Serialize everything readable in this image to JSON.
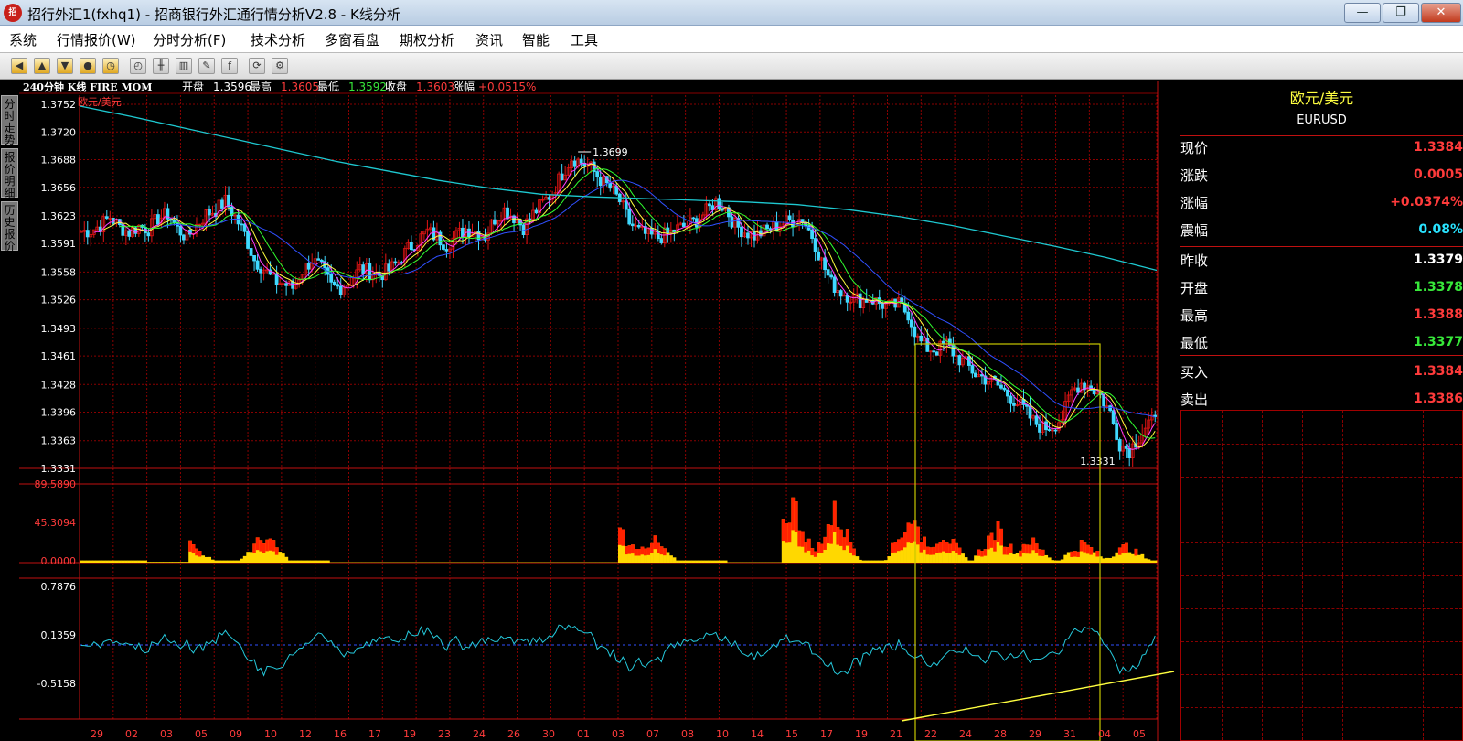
{
  "window": {
    "title": "招行外汇1(fxhq1) - 招商银行外汇通行情分析V2.8 - K线分析",
    "logo": "招"
  },
  "controls": {
    "min": "—",
    "max": "❐",
    "close": "✕"
  },
  "menu": [
    "系统",
    "行情报价(W)",
    "分时分析(F)",
    "技术分析",
    "多窗看盘",
    "期权分析",
    "资讯",
    "智能",
    "工具"
  ],
  "toolbar_icons": [
    "left-arrow-icon",
    "up-arrow-icon",
    "down-arrow-icon",
    "stop-icon",
    "clock-icon",
    "time-chart-icon",
    "kline-icon",
    "bar-chart-icon",
    "edit-icon",
    "fx-icon",
    "refresh-icon",
    "settings-icon"
  ],
  "side_tabs": [
    "分时走势",
    "报价明细",
    "历史报价"
  ],
  "chart_header": {
    "period": "240分钟 K线 FIRE MOM",
    "open_label": "开盘",
    "open": "1.3596",
    "high_label": "最高",
    "high": "1.3605",
    "low_label": "最低",
    "low": "1.3592",
    "close_label": "收盘",
    "close": "1.3603",
    "change_label": "涨幅",
    "change": "+0.0515%"
  },
  "chart_data": {
    "type": "candlestick",
    "symbol_label": "欧元/美元",
    "price_axis": [
      "1.3752",
      "1.3720",
      "1.3688",
      "1.3656",
      "1.3623",
      "1.3591",
      "1.3558",
      "1.3526",
      "1.3493",
      "1.3461",
      "1.3428",
      "1.3396",
      "1.3363",
      "1.3331"
    ],
    "ylim": [
      1.3331,
      1.3752
    ],
    "max_annotation": "1.3699",
    "min_annotation": "1.3331",
    "x_ticks": [
      "29",
      "02",
      "03",
      "05",
      "09",
      "10",
      "12",
      "16",
      "17",
      "19",
      "23",
      "24",
      "26",
      "30",
      "01",
      "03",
      "07",
      "08",
      "10",
      "14",
      "15",
      "17",
      "19",
      "21",
      "22",
      "24",
      "28",
      "29",
      "31",
      "04",
      "05"
    ],
    "price_path": [
      1.3605,
      1.3606,
      1.3612,
      1.3622,
      1.361,
      1.3604,
      1.3611,
      1.3608,
      1.362,
      1.3625,
      1.3608,
      1.3598,
      1.3612,
      1.3625,
      1.363,
      1.364,
      1.3622,
      1.3602,
      1.3572,
      1.3562,
      1.3548,
      1.3545,
      1.354,
      1.356,
      1.3572,
      1.3562,
      1.3542,
      1.354,
      1.3548,
      1.3562,
      1.3558,
      1.3555,
      1.356,
      1.357,
      1.3585,
      1.3595,
      1.3605,
      1.3598,
      1.359,
      1.36,
      1.3608,
      1.3605,
      1.36,
      1.362,
      1.363,
      1.3622,
      1.361,
      1.3625,
      1.3638,
      1.365,
      1.3672,
      1.369,
      1.3685,
      1.3678,
      1.3665,
      1.3655,
      1.364,
      1.3615,
      1.3605,
      1.36,
      1.3598,
      1.3602,
      1.3608,
      1.3612,
      1.3618,
      1.3628,
      1.364,
      1.3632,
      1.3612,
      1.3605,
      1.36,
      1.3605,
      1.361,
      1.3615,
      1.3618,
      1.362,
      1.36,
      1.357,
      1.3545,
      1.3535,
      1.353,
      1.3525,
      1.3528,
      1.3522,
      1.3518,
      1.352,
      1.351,
      1.348,
      1.347,
      1.3468,
      1.3475,
      1.346,
      1.3452,
      1.344,
      1.3435,
      1.343,
      1.342,
      1.341,
      1.34,
      1.3385,
      1.3378,
      1.338,
      1.339,
      1.342,
      1.343,
      1.3425,
      1.3415,
      1.3395,
      1.336,
      1.3352,
      1.3368,
      1.3384
    ],
    "ma_long": [
      1.375,
      1.3738,
      1.3725,
      1.3712,
      1.3699,
      1.3686,
      1.3675,
      1.3664,
      1.3655,
      1.3648,
      1.3645,
      1.3643,
      1.3641,
      1.3639,
      1.3636,
      1.363,
      1.3622,
      1.3612,
      1.36,
      1.3588,
      1.3575,
      1.356
    ],
    "vol_axis": [
      "89.5890",
      "45.3094",
      "0.0000"
    ],
    "vol_max": 89.589,
    "mom_axis": [
      "0.7876",
      "0.1359",
      "-0.5158"
    ],
    "mom_lim": [
      -1.0,
      0.9
    ],
    "mom_ref": 0.0
  },
  "side_panel": {
    "name": "欧元/美元",
    "code": "EURUSD",
    "rows": [
      {
        "label": "现价",
        "value": "1.3384",
        "color": "#ff3b3b"
      },
      {
        "label": "涨跌",
        "value": "0.0005",
        "color": "#ff3b3b"
      },
      {
        "label": "涨幅",
        "value": "+0.0374%",
        "color": "#ff3b3b"
      },
      {
        "label": "震幅",
        "value": "0.08%",
        "color": "#29e3ff"
      },
      {
        "label": "昨收",
        "value": "1.3379",
        "color": "#ffffff"
      },
      {
        "label": "开盘",
        "value": "1.3378",
        "color": "#37e83a"
      },
      {
        "label": "最高",
        "value": "1.3388",
        "color": "#ff3b3b"
      },
      {
        "label": "最低",
        "value": "1.3377",
        "color": "#37e83a"
      },
      {
        "label": "买入",
        "value": "1.3384",
        "color": "#ff3b3b"
      },
      {
        "label": "卖出",
        "value": "1.3386",
        "color": "#ff3b3b"
      }
    ]
  },
  "colors": {
    "grid": "#8a0000",
    "up": "#e11414",
    "down": "#3fd9ff",
    "ma_long": "#1ec8d0",
    "ma1": "#ffffff",
    "ma2": "#ffff40",
    "ma3": "#ff40ff",
    "ma4": "#30ff30",
    "ma5": "#3050ff",
    "mom": "#25c9dc",
    "vol_bar": "#ffd800",
    "vol_hot": "#ff2200",
    "box": "#c8c800"
  }
}
